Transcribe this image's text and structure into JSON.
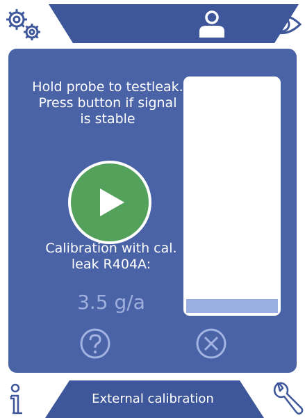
{
  "colors": {
    "panel": "#4a62a6",
    "primary_blue": "#3e569a",
    "play_button": "#54a15b",
    "value_text": "#9fb0df",
    "signal_fill": "#9aaee4",
    "light_icon": "#a4b4e2"
  },
  "icons": {
    "settings": "gears-icon",
    "user": "user-icon",
    "view": "eye-icon",
    "start": "play-icon",
    "help": "question-icon",
    "cancel": "close-icon",
    "info": "info-icon",
    "tools": "wrench-icon"
  },
  "main": {
    "instruction": "Hold probe to testleak. Press button if signal is stable",
    "calibration_label": "Calibration with cal. leak R404A:",
    "leak_rate": "3.5 g/a",
    "signal_level": 0.06
  },
  "bottom_bar": {
    "title": "External calibration"
  }
}
